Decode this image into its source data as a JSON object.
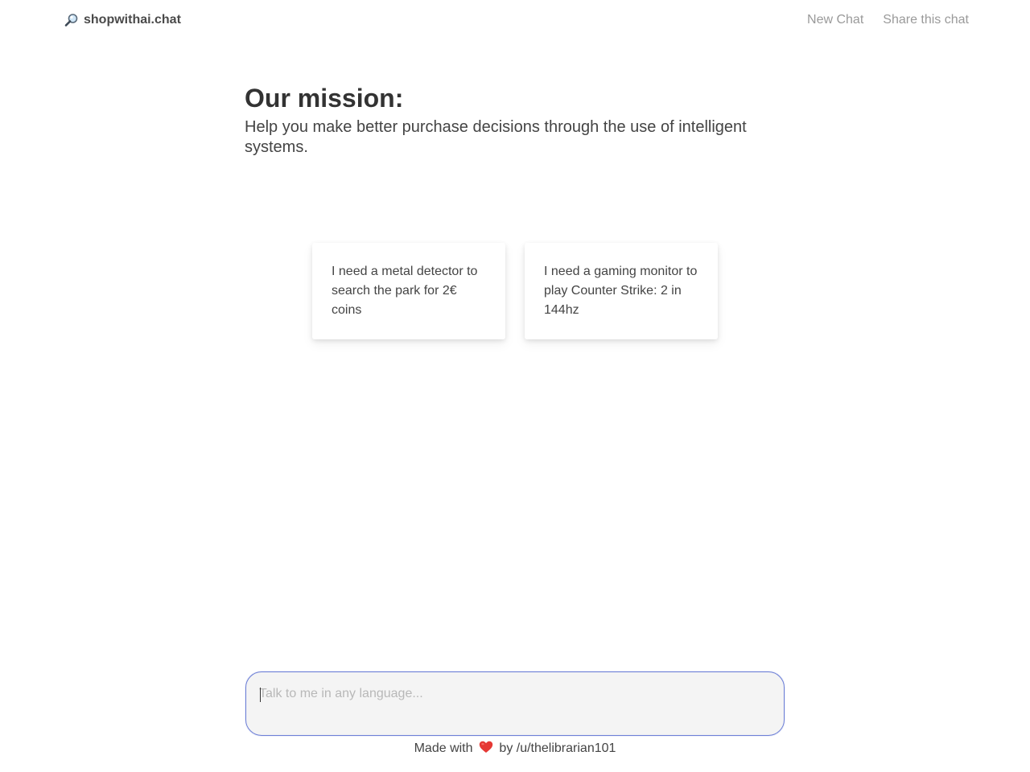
{
  "header": {
    "brand_name": "shopwithai.chat",
    "brand_icon": "magnifying-glass-icon",
    "nav": {
      "new_chat": "New Chat",
      "share_chat": "Share this chat"
    }
  },
  "mission": {
    "title": "Our mission:",
    "text": "Help you make better purchase decisions through the use of intelligent systems."
  },
  "suggestions": [
    {
      "text": "I need a metal detector to search the park for 2€ coins"
    },
    {
      "text": "I need a gaming monitor to play Counter Strike: 2 in 144hz"
    }
  ],
  "chat": {
    "placeholder": "Talk to me in any language...",
    "value": ""
  },
  "footer": {
    "prefix": "Made with",
    "icon": "heart-icon",
    "suffix": "by /u/thelibrarian101"
  },
  "colors": {
    "accent_border": "#6d7fd6",
    "heart": "#e53935",
    "nav_link": "#9a9a9a",
    "input_bg": "#f4f4f4"
  }
}
